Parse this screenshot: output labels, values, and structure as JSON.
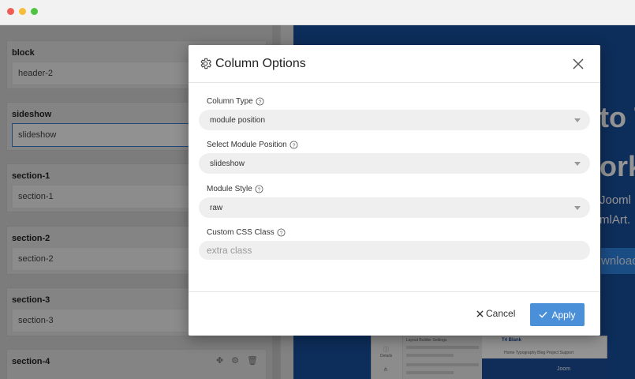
{
  "window": {
    "controls": [
      "close",
      "minimize",
      "maximize"
    ]
  },
  "layout_blocks": [
    {
      "title": "block",
      "value": "header-2"
    },
    {
      "title": "sideshow",
      "value": "slideshow"
    },
    {
      "title": "section-1",
      "value": "section-1"
    },
    {
      "title": "section-2",
      "value": "section-2"
    },
    {
      "title": "section-3",
      "value": "section-3"
    },
    {
      "title": "section-4",
      "value": ""
    }
  ],
  "preview": {
    "heading_fragment_1": "to T",
    "heading_fragment_2": "ork",
    "line_1": "Jooml",
    "line_2": "mlArt.",
    "button_fragment": "wnload",
    "thumb_brand": "T4 Blank",
    "thumb_settings_title": "Layout Builder Settings",
    "thumb_sidebar_label": "Details",
    "thumb_menu": "Home  Typography  Blog  Project  Support",
    "thumb_banner": "Joom"
  },
  "modal": {
    "title": "Column Options",
    "fields": {
      "column_type": {
        "label": "Column Type",
        "value": "module position"
      },
      "module_position": {
        "label": "Select Module Position",
        "value": "slideshow"
      },
      "module_style": {
        "label": "Module Style",
        "value": "raw"
      },
      "custom_css": {
        "label": "Custom CSS Class",
        "value": "",
        "placeholder": "extra class"
      }
    },
    "footer": {
      "cancel_label": "Cancel",
      "apply_label": "Apply"
    },
    "colors": {
      "apply": "#4a90d9",
      "field_bg": "#efefef"
    }
  }
}
